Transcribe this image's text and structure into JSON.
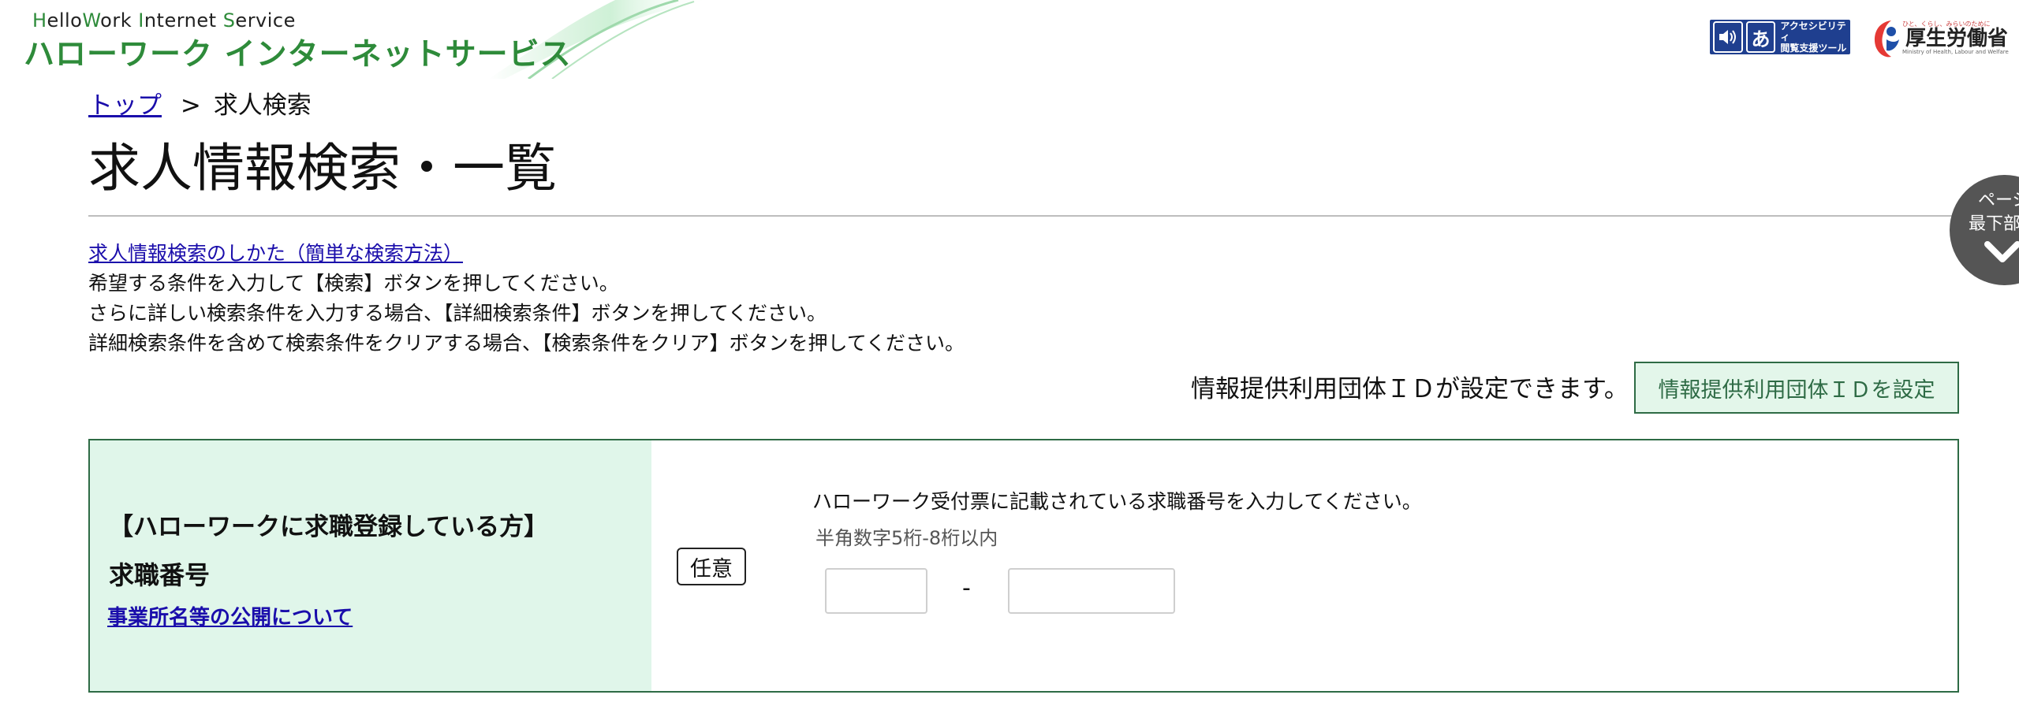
{
  "header": {
    "logo_en_parts": [
      "H",
      "ello",
      "W",
      "ork ",
      "I",
      "nternet ",
      "S",
      "ervice"
    ],
    "logo_jp": "ハローワーク インターネットサービス",
    "a11y_tool_label_line1": "アクセシビリティ",
    "a11y_tool_label_line2": "閲覧支援ツール",
    "a11y_tool_glyph": "あ",
    "ministry_tagline": "ひと、くらし、みらいのために",
    "ministry_name": "厚生労働省",
    "ministry_name_en": "Ministry of Health, Labour and Welfare"
  },
  "breadcrumb": {
    "home_label": "トップ",
    "separator": ">",
    "current": "求人検索"
  },
  "page_title": "求人情報検索・一覧",
  "intro": {
    "howto_link": "求人情報検索のしかた（簡単な検索方法）",
    "lines": [
      "希望する条件を入力して【検索】ボタンを押してください。",
      "さらに詳しい検索条件を入力する場合、【詳細検索条件】ボタンを押してください。",
      "詳細検索条件を含めて検索条件をクリアする場合、【検索条件をクリア】ボタンを押してください。"
    ]
  },
  "org_id": {
    "text": "情報提供利用団体ＩＤが設定できます。",
    "button_label": "情報提供利用団体ＩＤを設定"
  },
  "scroll_button": {
    "line1": "ページ",
    "line2": "最下部へ"
  },
  "job_seeker_number": {
    "group_title": "【ハローワークに求職登録している方】",
    "field_label": "求職番号",
    "disclosure_link": "事業所名等の公開について",
    "badge": "任意",
    "description": "ハローワーク受付票に記載されている求職番号を入力してください。",
    "hint": "半角数字5桁-8桁以内",
    "separator": "-",
    "value_first": "",
    "value_second": ""
  },
  "colors": {
    "brand_green": "#2e8b3a",
    "label_cell_bg": "#e0f6ea",
    "border_green": "#2e6b45",
    "link_blue": "#1a0dab",
    "a11y_blue": "#1f3f8f"
  }
}
